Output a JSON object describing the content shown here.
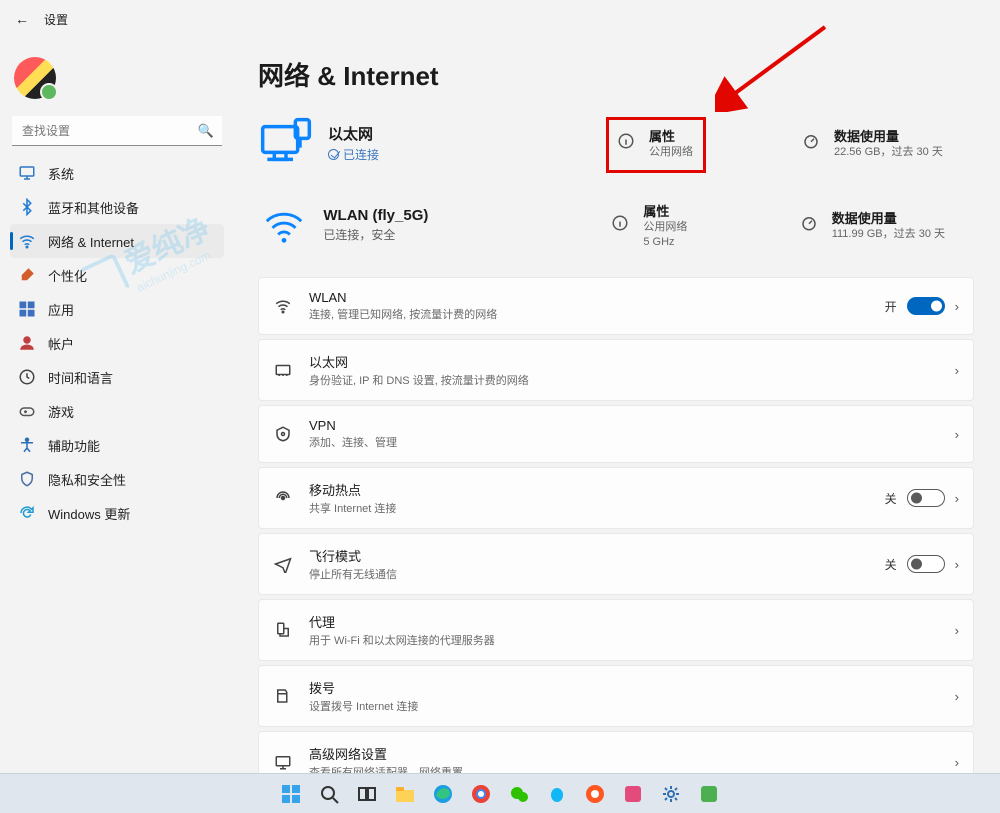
{
  "header": {
    "title": "设置"
  },
  "sidebar": {
    "search_placeholder": "查找设置",
    "items": [
      {
        "label": "系统",
        "icon": "system-icon",
        "color": "#2f78c5"
      },
      {
        "label": "蓝牙和其他设备",
        "icon": "bluetooth-icon",
        "color": "#1e7bd6"
      },
      {
        "label": "网络 & Internet",
        "icon": "wifi-icon",
        "color": "#1e7bd6",
        "active": true
      },
      {
        "label": "个性化",
        "icon": "brush-icon",
        "color": "#d45b2a"
      },
      {
        "label": "应用",
        "icon": "apps-icon",
        "color": "#3c6fbf"
      },
      {
        "label": "帐户",
        "icon": "account-icon",
        "color": "#c04040"
      },
      {
        "label": "时间和语言",
        "icon": "time-lang-icon",
        "color": "#444"
      },
      {
        "label": "游戏",
        "icon": "gaming-icon",
        "color": "#555"
      },
      {
        "label": "辅助功能",
        "icon": "accessibility-icon",
        "color": "#2a6fb5"
      },
      {
        "label": "隐私和安全性",
        "icon": "privacy-icon",
        "color": "#4a6fa5"
      },
      {
        "label": "Windows 更新",
        "icon": "update-icon",
        "color": "#1f9bd1"
      }
    ]
  },
  "page_title": "网络 & Internet",
  "connections": [
    {
      "name": "以太网",
      "status_primary": "已连接",
      "status_secondary": "",
      "icon": "ethernet-big-icon",
      "properties": {
        "title": "属性",
        "sub": "公用网络"
      },
      "usage": {
        "title": "数据使用量",
        "sub": "22.56 GB，过去 30 天"
      },
      "highlighted": true
    },
    {
      "name": "WLAN (fly_5G)",
      "status_primary": "已连接，安全",
      "status_secondary": "",
      "icon": "wifi-big-icon",
      "properties": {
        "title": "属性",
        "sub": "公用网络\n5 GHz"
      },
      "usage": {
        "title": "数据使用量",
        "sub": "111.99 GB，过去 30 天"
      },
      "highlighted": false
    }
  ],
  "cards": [
    {
      "icon": "wifi-icon",
      "title": "WLAN",
      "sub": "连接, 管理已知网络, 按流量计费的网络",
      "toggle": "on",
      "state_label": "开"
    },
    {
      "icon": "ethernet-icon",
      "title": "以太网",
      "sub": "身份验证, IP 和 DNS 设置, 按流量计费的网络"
    },
    {
      "icon": "vpn-icon",
      "title": "VPN",
      "sub": "添加、连接、管理"
    },
    {
      "icon": "hotspot-icon",
      "title": "移动热点",
      "sub": "共享 Internet 连接",
      "toggle": "off",
      "state_label": "关"
    },
    {
      "icon": "airplane-icon",
      "title": "飞行模式",
      "sub": "停止所有无线通信",
      "toggle": "off",
      "state_label": "关"
    },
    {
      "icon": "proxy-icon",
      "title": "代理",
      "sub": "用于 Wi-Fi 和以太网连接的代理服务器"
    },
    {
      "icon": "dialup-icon",
      "title": "拨号",
      "sub": "设置拨号 Internet 连接"
    },
    {
      "icon": "advanced-icon",
      "title": "高级网络设置",
      "sub": "查看所有网络适配器，网络重置"
    }
  ],
  "watermark": {
    "main": "爱纯净",
    "sub": "aichunjing.com"
  },
  "taskbar": [
    "start-icon",
    "search-icon",
    "taskview-icon",
    "explorer-icon",
    "edge-icon",
    "chrome-icon",
    "wechat-icon",
    "qq-icon",
    "browser2-icon",
    "app1-icon",
    "settings-icon",
    "app2-icon"
  ]
}
